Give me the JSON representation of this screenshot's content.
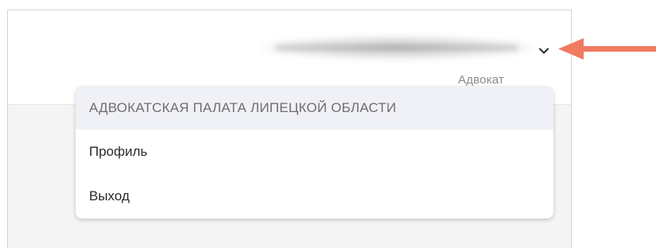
{
  "header": {
    "user_role": "Адвокат"
  },
  "menu": {
    "organization": "АДВОКАТСКАЯ ПАЛАТА ЛИПЕЦКОЙ ОБЛАСТИ",
    "items": [
      {
        "label": "Профиль"
      },
      {
        "label": "Выход"
      }
    ]
  },
  "icons": {
    "dropdown": "chevron-down-icon",
    "callout": "arrow-left-icon"
  },
  "colors": {
    "callout_arrow": "#f07a62",
    "menu_header_bg": "#f0f1f6"
  }
}
